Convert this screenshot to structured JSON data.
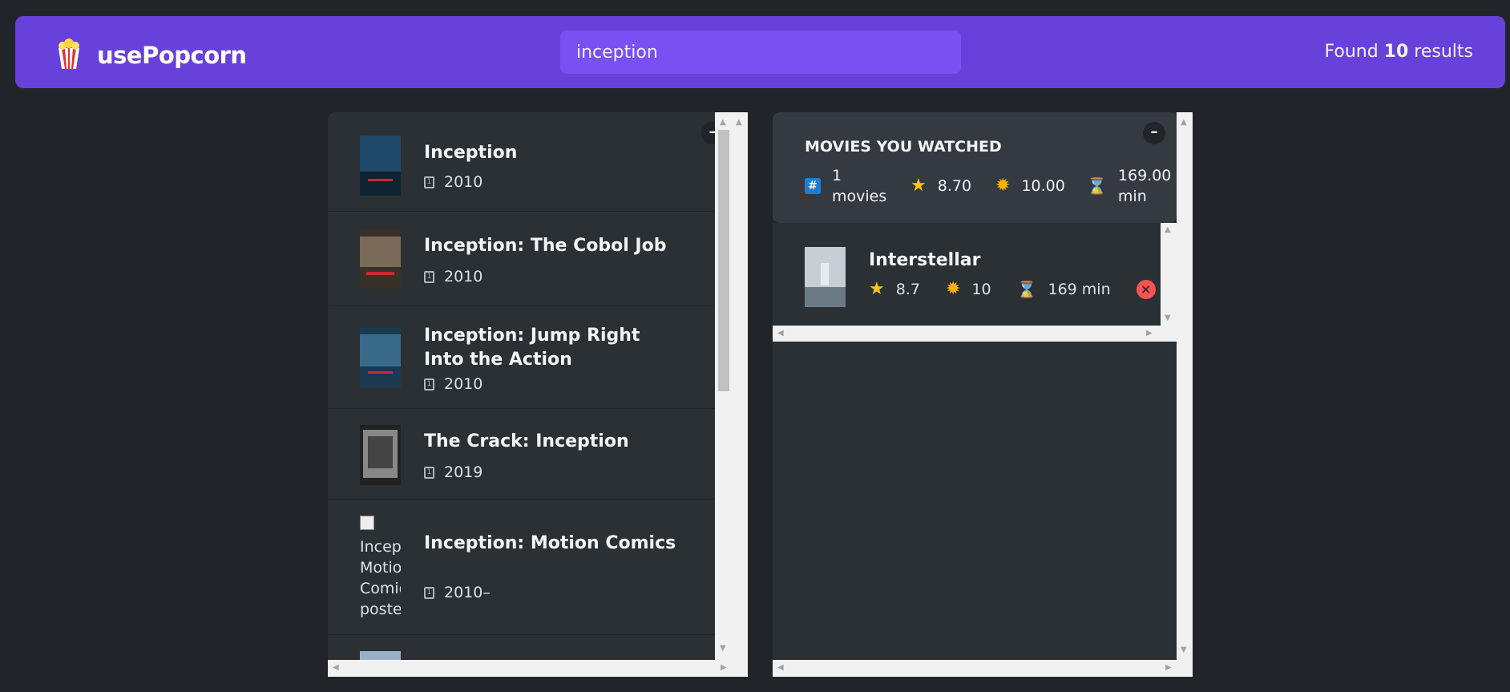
{
  "nav": {
    "logo_emoji": "🍿",
    "title": "usePopcorn",
    "search_value": "inception",
    "found_prefix": "Found",
    "found_count": "10",
    "found_suffix": "results"
  },
  "search_results": {
    "toggle_label": "–",
    "items": [
      {
        "title": "Inception",
        "year": "2010",
        "poster_color": "#1f4a6a"
      },
      {
        "title": "Inception: The Cobol Job",
        "year": "2010",
        "poster_color": "#5a4a3a"
      },
      {
        "title": "Inception: Jump Right Into the Action",
        "year": "2010",
        "poster_color": "#2a5a7a"
      },
      {
        "title": "The Crack: Inception",
        "year": "2019",
        "poster_color": "#777777"
      },
      {
        "title": "Inception: Motion Comics",
        "year": "2010–",
        "poster_alt": "Inception: Motion Comics poster"
      }
    ]
  },
  "watched": {
    "toggle_label": "–",
    "summary_title": "MOVIES YOU WATCHED",
    "stats": {
      "count_icon": "#️⃣",
      "count": "1 movies",
      "imdb_icon": "⭐️",
      "imdb": "8.70",
      "user_icon": "🌟",
      "user": "10.00",
      "runtime_icon": "⏳",
      "runtime": "169.00 min"
    },
    "items": [
      {
        "title": "Interstellar",
        "imdb": "8.7",
        "user": "10",
        "runtime": "169 min",
        "delete_label": "×"
      }
    ]
  }
}
